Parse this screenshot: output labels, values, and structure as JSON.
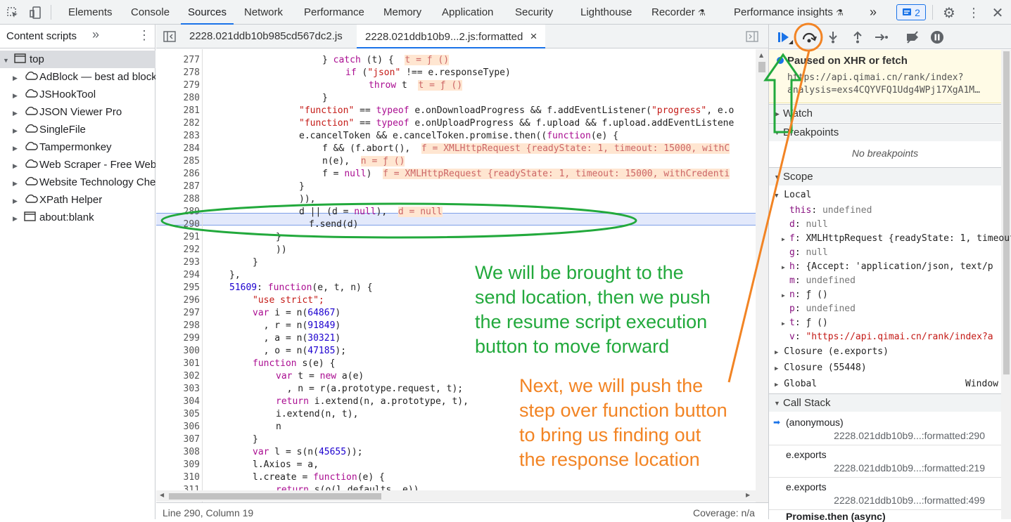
{
  "toolbar": {
    "tabs": [
      "Elements",
      "Console",
      "Sources",
      "Network",
      "Performance",
      "Memory",
      "Application",
      "Security",
      "Lighthouse",
      "Recorder",
      "Performance insights"
    ],
    "active_tab": "Sources",
    "more": "»",
    "issues_count": "2"
  },
  "navigator": {
    "tab_label": "Content scripts",
    "more": "»",
    "items": [
      {
        "label": "top",
        "icon": "frame-icon"
      },
      {
        "label": "AdBlock — best ad blocker",
        "icon": "cloud-icon"
      },
      {
        "label": "JSHookTool",
        "icon": "cloud-icon"
      },
      {
        "label": "JSON Viewer Pro",
        "icon": "cloud-icon"
      },
      {
        "label": "SingleFile",
        "icon": "cloud-icon"
      },
      {
        "label": "Tampermonkey",
        "icon": "cloud-icon"
      },
      {
        "label": "Web Scraper - Free Web Scraping",
        "icon": "cloud-icon"
      },
      {
        "label": "Website Technology Checker",
        "icon": "cloud-icon"
      },
      {
        "label": "XPath Helper",
        "icon": "cloud-icon"
      },
      {
        "label": "about:blank",
        "icon": "frame-icon"
      }
    ]
  },
  "editor": {
    "file_tabs": [
      "2228.021ddb10b985cd567dc2.js",
      "2228.021ddb10b9...2.js:formatted"
    ],
    "close": "×",
    "line_numbers": [
      "277",
      "278",
      "279",
      "280",
      "281",
      "282",
      "283",
      "284",
      "285",
      "286",
      "287",
      "288",
      "289",
      "290",
      "291",
      "292",
      "293",
      "294",
      "295",
      "296",
      "297",
      "298",
      "299",
      "300",
      "301",
      "302",
      "303",
      "304",
      "305",
      "306",
      "307",
      "308",
      "309",
      "310",
      "311"
    ],
    "status_position": "Line 290, Column 19",
    "status_coverage": "Coverage: n/a"
  },
  "code": {
    "l277a": "} ",
    "l277b": "catch",
    "l277c": " (t) {  ",
    "l277d": "t = ƒ ()",
    "l278a": "if",
    "l278b": " (",
    "l278c": "\"json\"",
    "l278d": " !== e.responseType)",
    "l279a": "throw",
    "l279b": " t  ",
    "l279c": "t = ƒ ()",
    "l280": "}",
    "l281a": "\"function\"",
    "l281b": " == ",
    "l281c": "typeof",
    "l281d": " e.onDownloadProgress && f.addEventListener(",
    "l281e": "\"progress\"",
    "l281f": ", e.o",
    "l282a": "\"function\"",
    "l282b": " == ",
    "l282c": "typeof",
    "l282d": " e.onUploadProgress && f.upload && f.upload.addEventListene",
    "l283a": "e.cancelToken && e.cancelToken.promise.then((",
    "l283b": "function",
    "l283c": "(e) {",
    "l284a": "f && (f.abort(),  ",
    "l284b": "f = XMLHttpRequest {readyState: 1, timeout: 15000, withC",
    "l285a": "n(e),  ",
    "l285b": "n = ƒ ()",
    "l286a": "f = ",
    "l286b": "null",
    "l286c": ")  ",
    "l286d": "f = XMLHttpRequest {readyState: 1, timeout: 15000, withCredenti",
    "l287": "}",
    "l288": ")),",
    "l289a": "d || (d = ",
    "l289b": "null",
    "l289c": "),  ",
    "l289d": "d = null",
    "l290": "f.send(d)",
    "l291": "}",
    "l292": "))",
    "l293": "}",
    "l294": "},",
    "l295a": "51609",
    "l295b": ": ",
    "l295c": "function",
    "l295d": "(e, t, n) {",
    "l296": "\"use strict\";",
    "l297a": "var",
    "l297b": " i = n(",
    "l297c": "64867",
    "l297d": ")",
    "l298a": "  , r = n(",
    "l298b": "91849",
    "l298c": ")",
    "l299a": "  , a = n(",
    "l299b": "30321",
    "l299c": ")",
    "l300a": "  , o = n(",
    "l300b": "47185",
    "l300c": ");",
    "l301a": "function",
    "l301b": " s(e) {",
    "l302a": "var",
    "l302b": " t = ",
    "l302c": "new",
    "l302d": " a(e)",
    "l303": "  , n = r(a.prototype.request, t);",
    "l304a": "return",
    "l304b": " i.extend(n, a.prototype, t),",
    "l305": "i.extend(n, t),",
    "l306": "n",
    "l307": "}",
    "l308a": "var",
    "l308b": " l = s(n(",
    "l308c": "45655",
    "l308d": "));",
    "l309": "l.Axios = a,",
    "l310a": "l.create = ",
    "l310b": "function",
    "l310c": "(e) {",
    "l311a": "return",
    "l311b": " s(o(l.defaults, e))"
  },
  "debugger": {
    "paused_title": "Paused on XHR or fetch",
    "paused_url_1": "https://api.qimai.cn/rank/index?",
    "paused_url_2": "analysis=exs4CQYVFQ1Udg4WPj17XgA1M…",
    "watch": "Watch",
    "breakpoints": "Breakpoints",
    "no_breakpoints": "No breakpoints",
    "scope": "Scope",
    "local": "Local",
    "scope_vars": [
      {
        "name": "this",
        "value": "undefined",
        "expandable": false
      },
      {
        "name": "d",
        "value": "null",
        "expandable": false
      },
      {
        "name": "f",
        "value": "XMLHttpRequest {readyState: 1, timeout",
        "expandable": true
      },
      {
        "name": "g",
        "value": "null",
        "expandable": false
      },
      {
        "name": "h",
        "value": "{Accept: 'application/json, text/p",
        "expandable": true
      },
      {
        "name": "m",
        "value": "undefined",
        "expandable": false
      },
      {
        "name": "n",
        "value": "ƒ ()",
        "expandable": true
      },
      {
        "name": "p",
        "value": "undefined",
        "expandable": false
      },
      {
        "name": "t",
        "value": "ƒ ()",
        "expandable": true
      },
      {
        "name": "v",
        "value": "\"https://api.qimai.cn/rank/index?a",
        "expandable": false
      }
    ],
    "closure_1": "Closure (e.exports)",
    "closure_2": "Closure (55448)",
    "global": "Global",
    "global_value": "Window",
    "call_stack": "Call Stack",
    "frames": [
      {
        "fn": "(anonymous)",
        "loc": "2228.021ddb10b9...:formatted:290"
      },
      {
        "fn": "e.exports",
        "loc": "2228.021ddb10b9...:formatted:219"
      },
      {
        "fn": "e.exports",
        "loc": "2228.021ddb10b9...:formatted:499"
      }
    ],
    "promise_then": "Promise.then (async)"
  },
  "annotations": {
    "green_text": "We will be brought to the\nsend location, then we push\nthe resume script execution\nbutton to move forward",
    "orange_text": "Next, we will push the\nstep over function button\nto bring us finding out\nthe response location"
  },
  "colors": {
    "accent": "#1a73e8",
    "annotation_green": "#22a93c",
    "annotation_orange": "#f28424",
    "paused_banner": "#fffbe6",
    "current_line": "#e3e9fb"
  }
}
